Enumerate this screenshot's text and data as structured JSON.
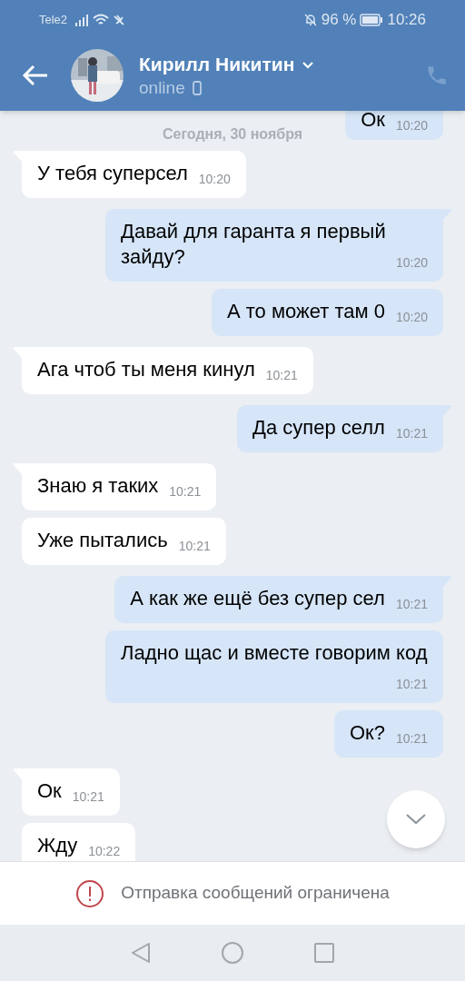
{
  "status_bar": {
    "carrier": "Tele2",
    "battery": "96 %",
    "time": "10:26"
  },
  "header": {
    "name": "Кирилл Никитин",
    "presence": "online"
  },
  "date_separator": "Сегодня, 30 ноября",
  "messages": [
    {
      "outgoing": true,
      "text": "Ок",
      "time": "10:20",
      "tail": false
    },
    {
      "outgoing": false,
      "text": "У тебя суперсел",
      "time": "10:20",
      "tail": true
    },
    {
      "outgoing": true,
      "text": "Давай для гаранта я первый зайду?",
      "time": "10:20",
      "tail": true
    },
    {
      "outgoing": true,
      "text": "А то может там 0",
      "time": "10:20",
      "tail": false
    },
    {
      "outgoing": false,
      "text": "Ага чтоб ты меня кинул",
      "time": "10:21",
      "tail": true
    },
    {
      "outgoing": true,
      "text": "Да супер селл",
      "time": "10:21",
      "tail": true
    },
    {
      "outgoing": false,
      "text": "Знаю я таких",
      "time": "10:21",
      "tail": true
    },
    {
      "outgoing": false,
      "text": "Уже пытались",
      "time": "10:21",
      "tail": false
    },
    {
      "outgoing": true,
      "text": "А как же ещё без супер сел",
      "time": "10:21",
      "tail": true
    },
    {
      "outgoing": true,
      "text": "Ладно щас и вместе говорим код",
      "time": "10:21",
      "tail": false
    },
    {
      "outgoing": true,
      "text": "Ок?",
      "time": "10:21",
      "tail": false
    },
    {
      "outgoing": false,
      "text": "Ок",
      "time": "10:21",
      "tail": true
    },
    {
      "outgoing": false,
      "text": "Жду",
      "time": "10:22",
      "tail": false
    }
  ],
  "notice": "Отправка сообщений ограничена"
}
